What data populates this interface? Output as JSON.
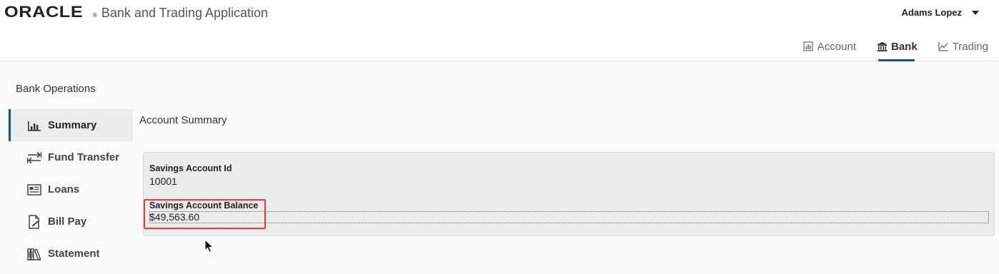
{
  "header": {
    "brand": "ORACLE",
    "brand_mark": "®",
    "app_title": "Bank and Trading Application",
    "user_name": "Adams Lopez",
    "nav": [
      {
        "label": "Account",
        "icon": "bar-chart-icon",
        "active": false
      },
      {
        "label": "Bank",
        "icon": "bank-icon",
        "active": true
      },
      {
        "label": "Trading",
        "icon": "line-chart-icon",
        "active": false
      }
    ]
  },
  "sidebar": {
    "title": "Bank Operations",
    "items": [
      {
        "label": "Summary",
        "icon": "summary-chart-icon",
        "active": true
      },
      {
        "label": "Fund Transfer",
        "icon": "transfer-icon",
        "active": false
      },
      {
        "label": "Loans",
        "icon": "loans-icon",
        "active": false
      },
      {
        "label": "Bill Pay",
        "icon": "bill-pay-icon",
        "active": false
      },
      {
        "label": "Statement",
        "icon": "statement-icon",
        "active": false
      }
    ]
  },
  "main": {
    "title": "Account Summary",
    "account_id_label": "Savings Account Id",
    "account_id_value": "10001",
    "balance_label": "Savings Account Balance",
    "balance_value": "$49,563.60"
  },
  "colors": {
    "accent": "#0b5b8c",
    "highlight": "#e53a3a",
    "card_bg": "#ebebeb"
  }
}
